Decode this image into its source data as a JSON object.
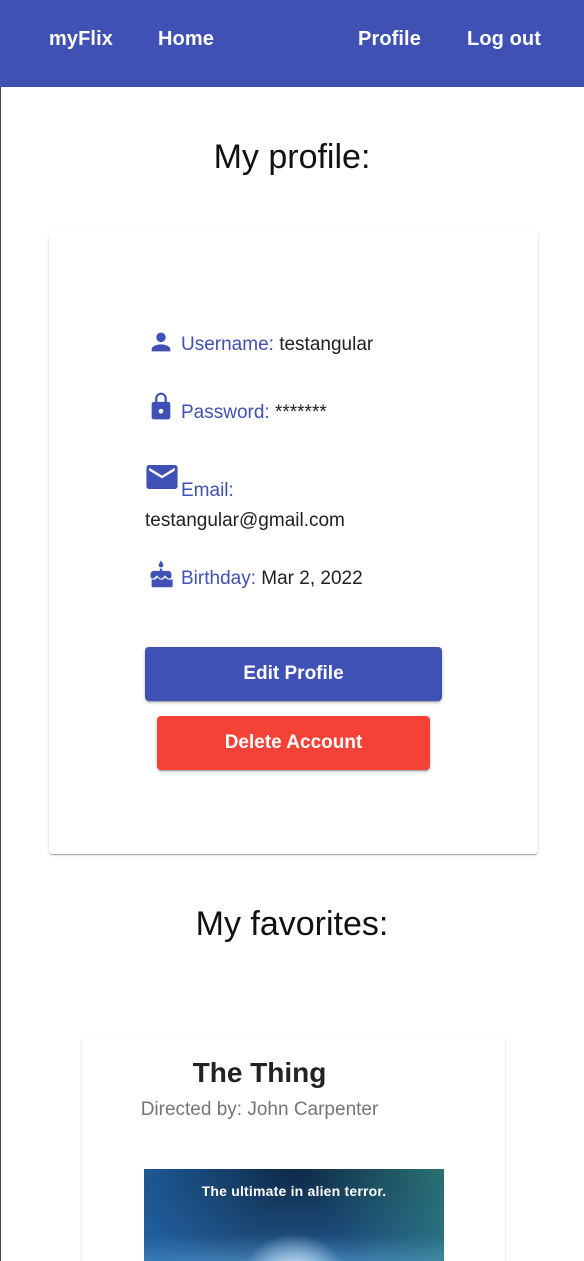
{
  "nav": {
    "brand": "myFlix",
    "home": "Home",
    "profile": "Profile",
    "logout": "Log out"
  },
  "profile": {
    "title": "My profile:",
    "username_label": "Username:",
    "username_value": "testangular",
    "password_label": "Password:",
    "password_value": "*******",
    "email_label": "Email:",
    "email_value": "testangular@gmail.com",
    "birthday_label": "Birthday:",
    "birthday_value": "Mar 2, 2022",
    "edit_button": "Edit Profile",
    "delete_button": "Delete Account"
  },
  "favorites": {
    "title": "My favorites:",
    "movies": [
      {
        "title": "The Thing",
        "director": "Directed by: John Carpenter",
        "poster_tagline": "The ultimate in alien terror."
      }
    ]
  },
  "colors": {
    "primary": "#3f51b5",
    "warn": "#f44336"
  },
  "icons": [
    "person-icon",
    "lock-icon",
    "email-icon",
    "cake-icon"
  ]
}
